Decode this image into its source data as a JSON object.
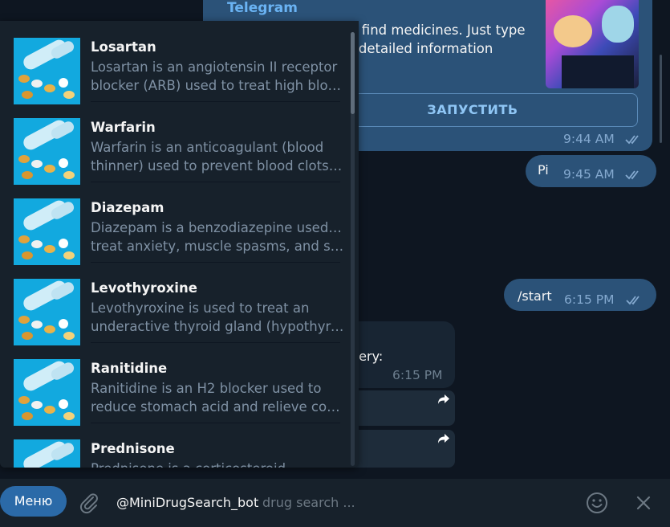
{
  "chat": {
    "bot_card": {
      "title": "Telegram",
      "text_line1": "ou find medicines. Just type",
      "text_line2": "et detailed information",
      "launch_label": "ЗАПУСТИТЬ",
      "time": "9:44 AM"
    },
    "messages": [
      {
        "text": "Pi",
        "time": "9:45 AM"
      },
      {
        "text": "/start",
        "time": "6:15 PM"
      }
    ],
    "incoming": {
      "text": "uery:",
      "time": "6:15 PM"
    }
  },
  "results": [
    {
      "name": "Losartan",
      "desc_line1": "Losartan is an angiotensin II receptor",
      "desc_line2": "blocker (ARB) used to treat high blood ..."
    },
    {
      "name": "Warfarin",
      "desc_line1": "Warfarin is an anticoagulant (blood",
      "desc_line2": "thinner) used to prevent blood clots a..."
    },
    {
      "name": "Diazepam",
      "desc_line1": "Diazepam is a benzodiazepine used to",
      "desc_line2": "treat anxiety, muscle spasms, and seiz..."
    },
    {
      "name": "Levothyroxine",
      "desc_line1": "Levothyroxine is used to treat an",
      "desc_line2": "underactive thyroid gland (hypothyroi..."
    },
    {
      "name": "Ranitidine",
      "desc_line1": "Ranitidine is an H2 blocker used to",
      "desc_line2": "reduce stomach acid and relieve condi..."
    },
    {
      "name": "Prednisone",
      "desc_line1": "Prednisone is a corticosteroid",
      "desc_line2": ""
    }
  ],
  "input": {
    "menu_label": "Меню",
    "query": "@MiniDrugSearch_bot",
    "placeholder": "drug search ..."
  },
  "icons": {
    "attach": "paperclip-icon",
    "emoji": "emoji-icon",
    "close": "close-icon",
    "forward": "forward-icon",
    "read": "double-check-icon"
  },
  "colors": {
    "background": "#0e1621",
    "outgoing_bubble": "#2b5278",
    "panel": "#17212b",
    "accent": "#2b6aa8",
    "link": "#6ab3f3",
    "thumb": "#12a9df"
  }
}
